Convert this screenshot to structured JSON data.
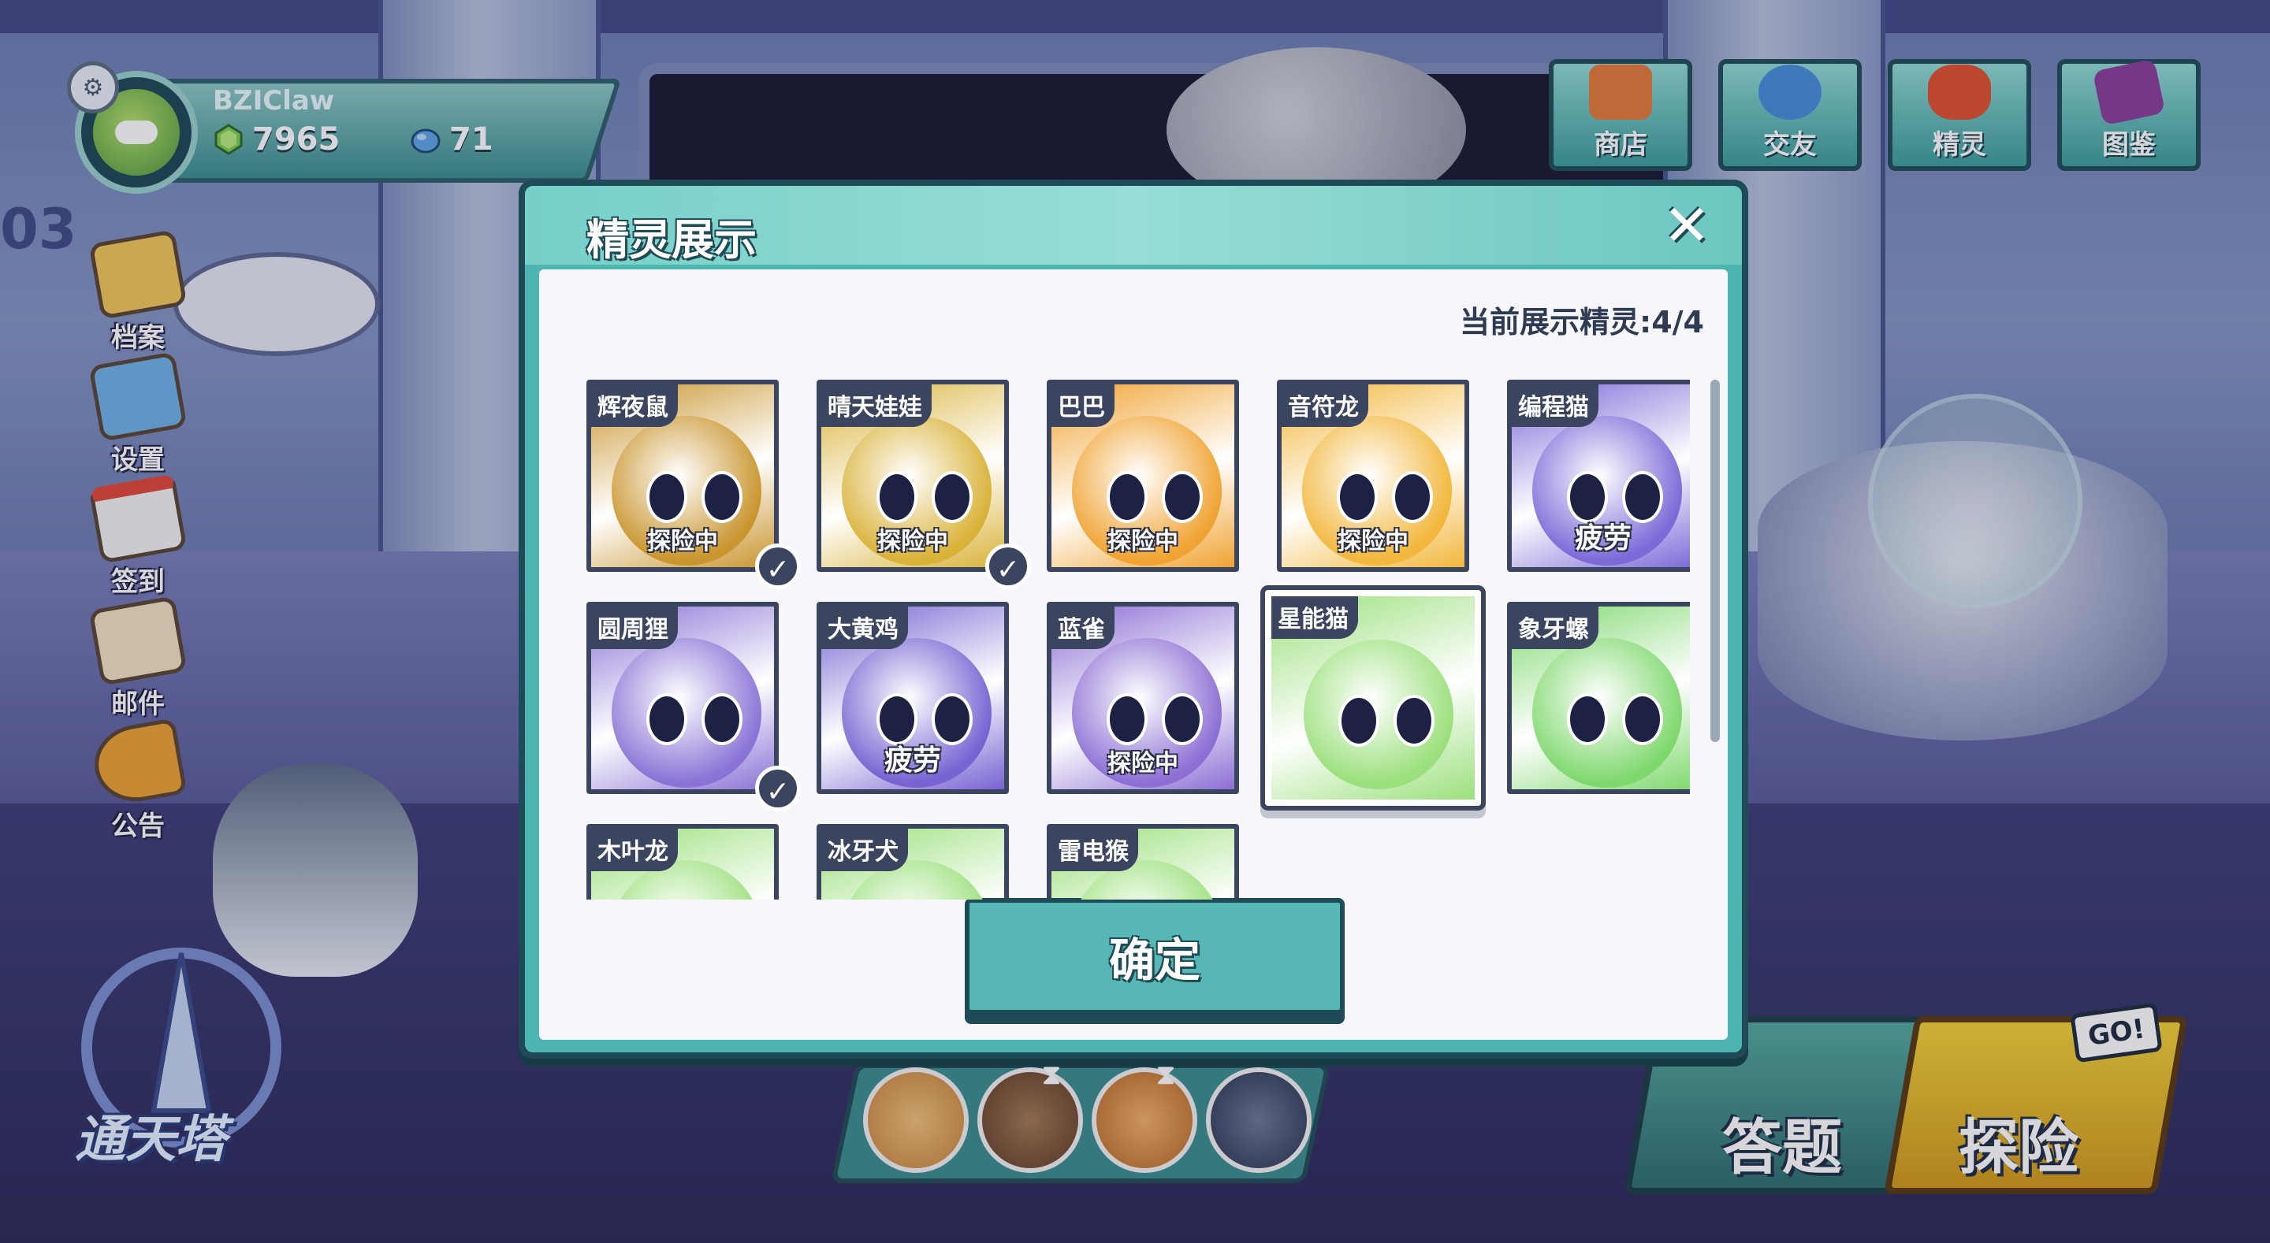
{
  "player": {
    "name": "BZIClaw",
    "currency_green": "7965",
    "currency_blue": "71"
  },
  "left_menu": [
    {
      "label": "档案",
      "icon": "profile-folder-icon"
    },
    {
      "label": "设置",
      "icon": "settings-keyboard-icon"
    },
    {
      "label": "签到",
      "icon": "checkin-calendar-icon"
    },
    {
      "label": "邮件",
      "icon": "mail-envelope-icon"
    },
    {
      "label": "公告",
      "icon": "announcement-megaphone-icon"
    }
  ],
  "top_nav": [
    {
      "label": "商店",
      "icon": "shop-icon",
      "color": "#e57a3a"
    },
    {
      "label": "交友",
      "icon": "chat-bubble-icon",
      "color": "#4a8fd9"
    },
    {
      "label": "精灵",
      "icon": "sprite-cat-icon",
      "color": "#e0522f"
    },
    {
      "label": "图鉴",
      "icon": "codex-book-icon",
      "color": "#8c3f9c"
    }
  ],
  "background": {
    "level_text": "03",
    "tower_label": "通天塔"
  },
  "bottom_actions": {
    "quiz": "答题",
    "explore": "探险",
    "go_badge": "GO!"
  },
  "modal": {
    "title": "精灵展示",
    "display_count": "当前展示精灵:4/4",
    "confirm": "确定",
    "sprites": [
      {
        "name": "辉夜鼠",
        "status": "探险中",
        "checked": true,
        "color": "#c9952e"
      },
      {
        "name": "晴天娃娃",
        "status": "探险中",
        "checked": true,
        "color": "#d9b238"
      },
      {
        "name": "巴巴",
        "status": "探险中",
        "checked": false,
        "color": "#f0a332"
      },
      {
        "name": "音符龙",
        "status": "探险中",
        "checked": false,
        "color": "#f2b73c"
      },
      {
        "name": "编程猫",
        "status": "疲劳",
        "checked": false,
        "color": "#7b6ad8"
      },
      {
        "name": "圆周狸",
        "status": "",
        "checked": true,
        "color": "#8a73d6"
      },
      {
        "name": "大黄鸡",
        "status": "疲劳",
        "checked": false,
        "color": "#7763d2"
      },
      {
        "name": "蓝雀",
        "status": "探险中",
        "checked": false,
        "color": "#8c6fd4"
      },
      {
        "name": "星能猫",
        "status": "",
        "checked": false,
        "color": "#9be07c"
      },
      {
        "name": "象牙螺",
        "status": "",
        "checked": false,
        "color": "#7fd86e"
      },
      {
        "name": "木叶龙",
        "status": "",
        "checked": false,
        "color": "#9be07c"
      },
      {
        "name": "冰牙犬",
        "status": "",
        "checked": false,
        "color": "#9be07c"
      },
      {
        "name": "雷电猴",
        "status": "",
        "checked": false,
        "color": "#9be07c"
      }
    ]
  }
}
